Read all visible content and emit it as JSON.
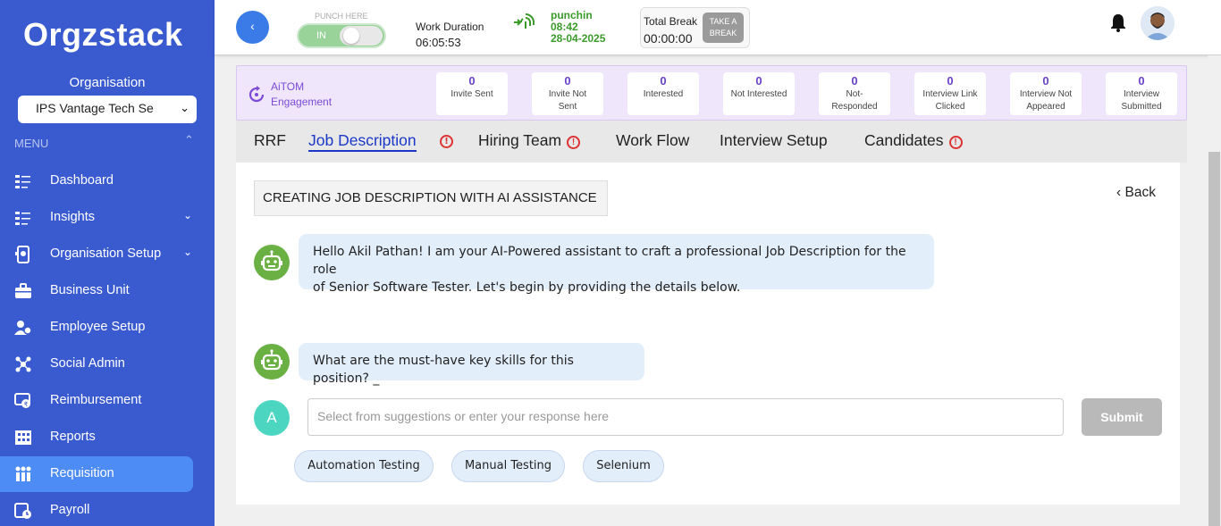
{
  "brand": {
    "logo_text": "Orgzstack"
  },
  "sidebar": {
    "org_label": "Organisation",
    "org_selected": "IPS Vantage Tech Se",
    "menu_label": "MENU",
    "items": [
      {
        "label": "Dashboard",
        "icon": "dashboard-icon",
        "has_arrow": false
      },
      {
        "label": "Insights",
        "icon": "insights-icon",
        "has_arrow": true
      },
      {
        "label": "Organisation Setup",
        "icon": "organisation-setup-icon",
        "has_arrow": true
      },
      {
        "label": "Business Unit",
        "icon": "briefcase-icon",
        "has_arrow": false
      },
      {
        "label": "Employee Setup",
        "icon": "employee-setup-icon",
        "has_arrow": false
      },
      {
        "label": "Social Admin",
        "icon": "social-admin-icon",
        "has_arrow": false
      },
      {
        "label": "Reimbursement",
        "icon": "reimbursement-icon",
        "has_arrow": false
      },
      {
        "label": "Reports",
        "icon": "reports-icon",
        "has_arrow": false
      },
      {
        "label": "Requisition",
        "icon": "requisition-icon",
        "has_arrow": false,
        "active": true
      },
      {
        "label": "Payroll",
        "icon": "payroll-icon",
        "has_arrow": false
      }
    ]
  },
  "topbar": {
    "back_glyph": "‹",
    "punch_here": "PUNCH HERE",
    "toggle_label": "IN",
    "work_duration_label": "Work Duration",
    "work_duration_value": "06:05:53",
    "punchin_label": "punchin",
    "punchin_time": "08:42",
    "punchin_date": "28-04-2025",
    "total_break_label": "Total Break",
    "total_break_value": "00:00:00",
    "take_break_line1": "TAKE A",
    "take_break_line2": "BREAK"
  },
  "aitom": {
    "title_line1": "AiTOM",
    "title_line2": "Engagement",
    "stats": [
      {
        "value": "0",
        "label1": "Invite Sent",
        "label2": ""
      },
      {
        "value": "0",
        "label1": "Invite Not",
        "label2": "Sent"
      },
      {
        "value": "0",
        "label1": "Interested",
        "label2": ""
      },
      {
        "value": "0",
        "label1": "Not Interested",
        "label2": ""
      },
      {
        "value": "0",
        "label1": "Not-",
        "label2": "Responded"
      },
      {
        "value": "0",
        "label1": "Interview Link",
        "label2": "Clicked"
      },
      {
        "value": "0",
        "label1": "Interview Not",
        "label2": "Appeared"
      },
      {
        "value": "0",
        "label1": "Interview",
        "label2": "Submitted"
      }
    ]
  },
  "tabs": [
    {
      "label": "RRF",
      "warning": false,
      "active": false
    },
    {
      "label": "Job Description",
      "warning": true,
      "active": true
    },
    {
      "label": "Hiring Team",
      "warning": true,
      "active": false
    },
    {
      "label": "Work Flow",
      "warning": false,
      "active": false
    },
    {
      "label": "Interview Setup",
      "warning": false,
      "active": false
    },
    {
      "label": "Candidates",
      "warning": true,
      "active": false
    }
  ],
  "panel": {
    "heading": "CREATING JOB DESCRIPTION WITH AI ASSISTANCE",
    "back_label": "Back",
    "messages": [
      {
        "text_line1": "Hello Akil Pathan! I am your AI-Powered assistant to craft a professional Job Description for the role",
        "text_line2": "of Senior Software Tester. Let's begin by providing the details below."
      },
      {
        "text_line1": "What are the must-have key skills for this position? _",
        "text_line2": ""
      }
    ],
    "user_initial": "A",
    "input_placeholder": "Select from suggestions or enter your response here",
    "submit_label": "Submit",
    "suggestions": [
      "Automation Testing",
      "Manual Testing",
      "Selenium"
    ]
  },
  "colors": {
    "sidebar_bg": "#3a5bd0",
    "active_item": "#4d8cf5",
    "accent_purple": "#6a42c8",
    "tab_active": "#1a37c8",
    "warning": "#dd3333",
    "punch_green": "#3a9a2a",
    "bot_green": "#6ab043",
    "user_teal": "#4cd6c1"
  }
}
